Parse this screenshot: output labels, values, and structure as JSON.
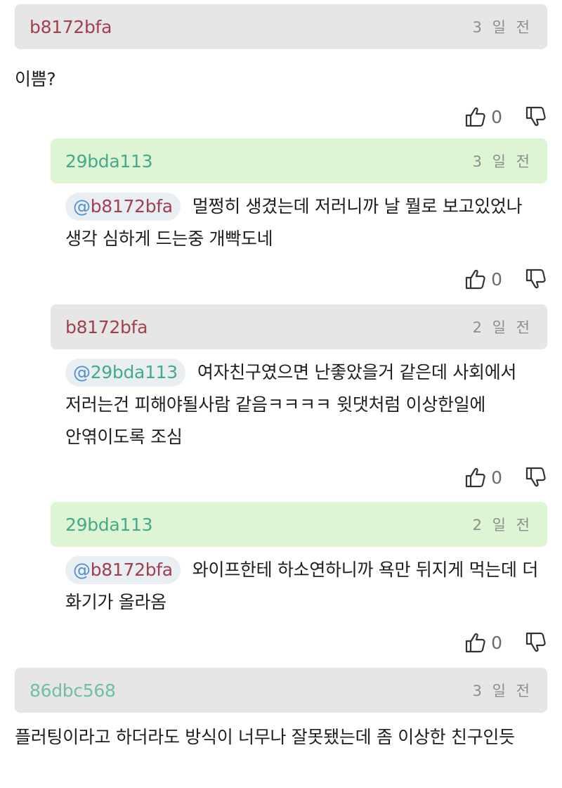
{
  "comments": [
    {
      "author": "b8172bfa",
      "time": "3 일 전",
      "mention": "",
      "text": "이쁨?",
      "likes": "0"
    },
    {
      "author": "29bda113",
      "time": "3 일 전",
      "mention": "b8172bfa",
      "text": "멀쩡히 생겼는데 저러니까 날 뭘로 보고있었나 생각 심하게 드는중 개빡도네",
      "likes": "0"
    },
    {
      "author": "b8172bfa",
      "time": "2 일 전",
      "mention": "29bda113",
      "text": "여자친구였으면 난좋았을거 같은데 사회에서 저러는건 피해야될사람 같음ㅋㅋㅋㅋ 윗댓처럼 이상한일에 안엮이도록 조심",
      "likes": "0"
    },
    {
      "author": "29bda113",
      "time": "2 일 전",
      "mention": "b8172bfa",
      "text": "와이프한테 하소연하니까 욕만 뒤지게 먹는데 더 화기가 올라옴",
      "likes": "0"
    },
    {
      "author": "86dbc568",
      "time": "3 일 전",
      "mention": "",
      "text": "플러팅이라고 하더라도 방식이 너무나 잘못됐는데 좀 이상한 친구인듯",
      "likes": ""
    }
  ],
  "mention_prefix": "@",
  "icons": {
    "like": "thumbs-up-icon",
    "dislike": "thumbs-down-icon"
  },
  "colors": {
    "author_red": "#a1404e",
    "author_teal": "#45a98b",
    "author_mint": "#6ebfa8",
    "header_gray": "#e6e6e6",
    "header_green": "#ddf5d2",
    "mention_bg": "#e9eef3"
  }
}
